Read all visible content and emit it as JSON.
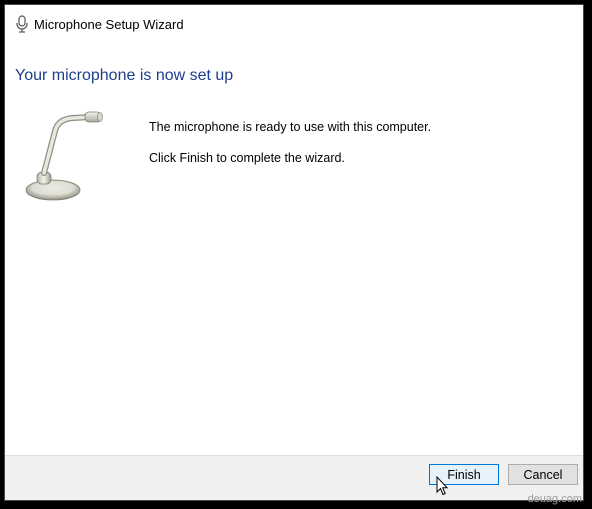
{
  "window": {
    "title": "Microphone Setup Wizard",
    "title_icon": "microphone-icon"
  },
  "content": {
    "heading": "Your microphone is now set up",
    "illustration": "desk-microphone-illustration",
    "message_ready": "The microphone is ready to use with this computer.",
    "message_finish": "Click Finish to complete the wizard."
  },
  "footer": {
    "finish_label": "Finish",
    "cancel_label": "Cancel"
  },
  "watermark": "deuag.com",
  "colors": {
    "heading": "#1c3f8c",
    "focus_border": "#0078d7",
    "footer_bg": "#f0f0f0"
  }
}
